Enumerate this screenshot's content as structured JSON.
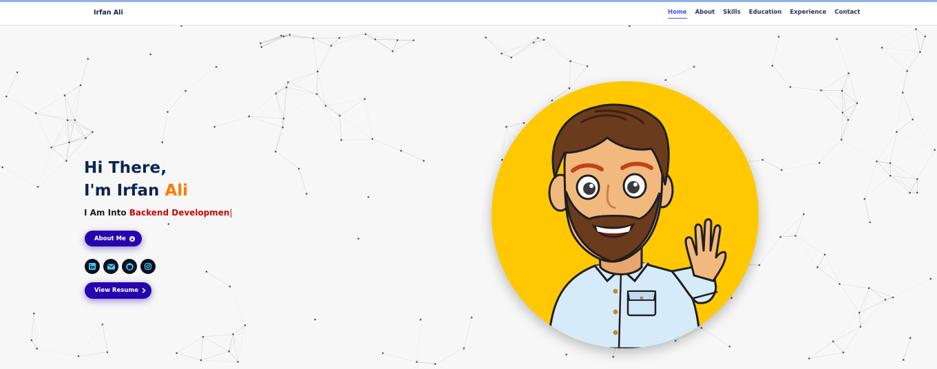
{
  "brand": "Irfan Ali",
  "nav": {
    "items": [
      {
        "label": "Home",
        "active": true
      },
      {
        "label": "About",
        "active": false
      },
      {
        "label": "Skills",
        "active": false
      },
      {
        "label": "Education",
        "active": false
      },
      {
        "label": "Experience",
        "active": false
      },
      {
        "label": "Contact",
        "active": false
      }
    ]
  },
  "hero": {
    "greeting": "Hi There,",
    "intro_prefix": "I'm Irfan ",
    "intro_accent": "Ali",
    "typed_prefix": "I Am Into ",
    "typed_text": "Backend Developmen",
    "caret": "|",
    "about_button": "About Me",
    "resume_button": "View Resume"
  },
  "socials": [
    {
      "name": "linkedin-icon"
    },
    {
      "name": "mail-icon"
    },
    {
      "name": "github-icon"
    },
    {
      "name": "instagram-icon"
    }
  ],
  "avatar": {
    "name": "cartoon-avatar"
  },
  "colors": {
    "navy": "#0b2554",
    "accent_orange": "#ff7a00",
    "typed_red": "#c70707",
    "button": "#2506ad",
    "nav_active": "#3b5bdb",
    "avatar_bg": "#ffc800"
  }
}
